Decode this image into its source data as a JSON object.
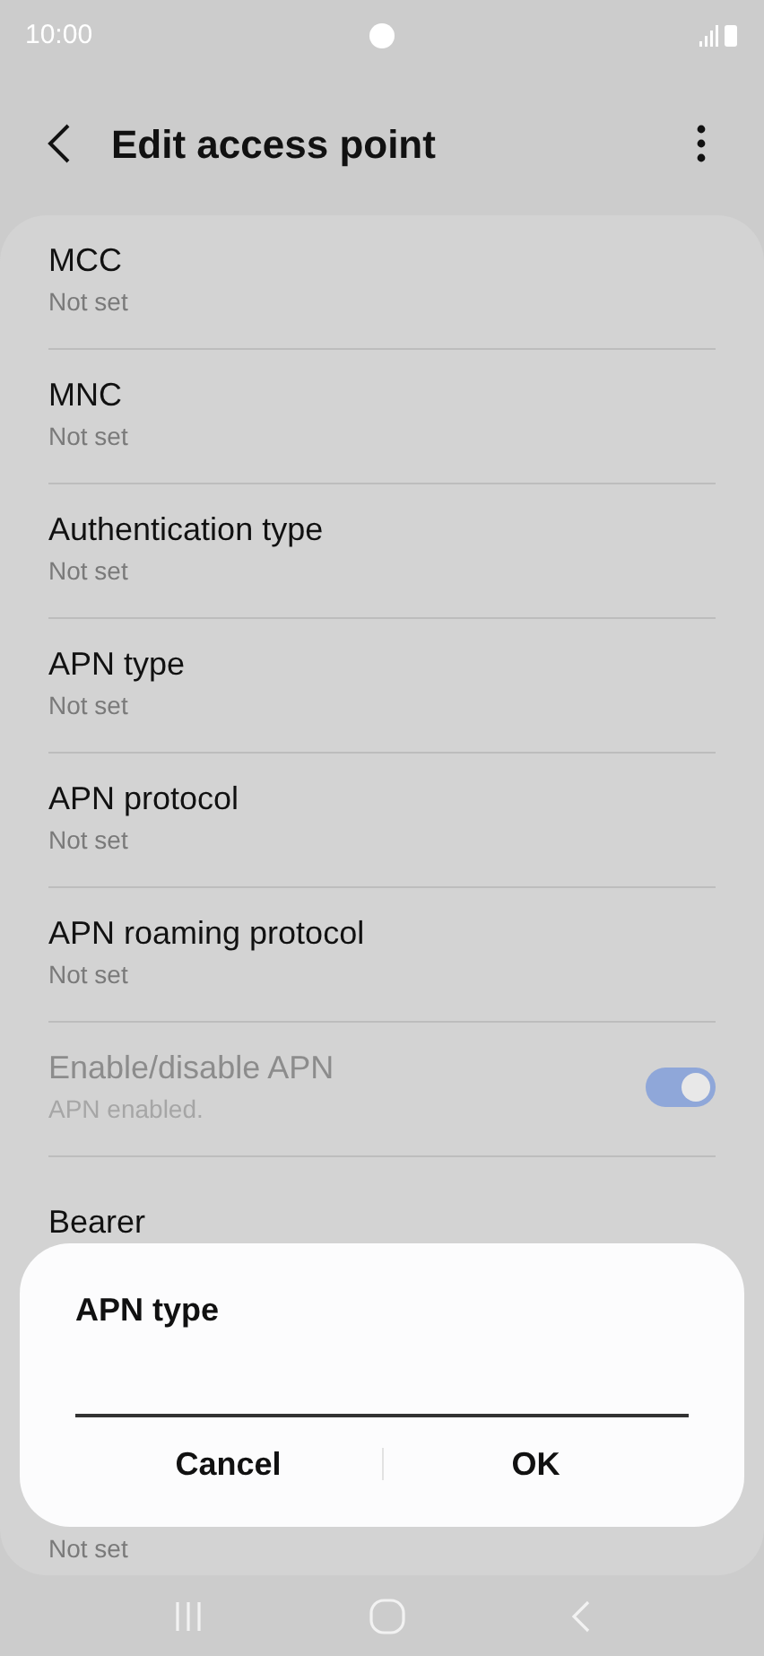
{
  "status_bar": {
    "time": "10:00"
  },
  "header": {
    "title": "Edit access point"
  },
  "items": [
    {
      "kind": "text",
      "title": "MCC",
      "subtitle": "Not set"
    },
    {
      "kind": "text",
      "title": "MNC",
      "subtitle": "Not set"
    },
    {
      "kind": "text",
      "title": "Authentication type",
      "subtitle": "Not set"
    },
    {
      "kind": "text",
      "title": "APN type",
      "subtitle": "Not set"
    },
    {
      "kind": "text",
      "title": "APN protocol",
      "subtitle": "Not set"
    },
    {
      "kind": "text",
      "title": "APN roaming protocol",
      "subtitle": "Not set"
    },
    {
      "kind": "toggle",
      "title": "Enable/disable APN",
      "subtitle": "APN enabled.",
      "disabled": true,
      "on": true
    },
    {
      "kind": "text",
      "title": "Bearer"
    },
    {
      "kind": "text",
      "subtitle": "Not set"
    }
  ],
  "dialog": {
    "title": "APN type",
    "buttons": [
      "Cancel",
      "OK"
    ]
  }
}
